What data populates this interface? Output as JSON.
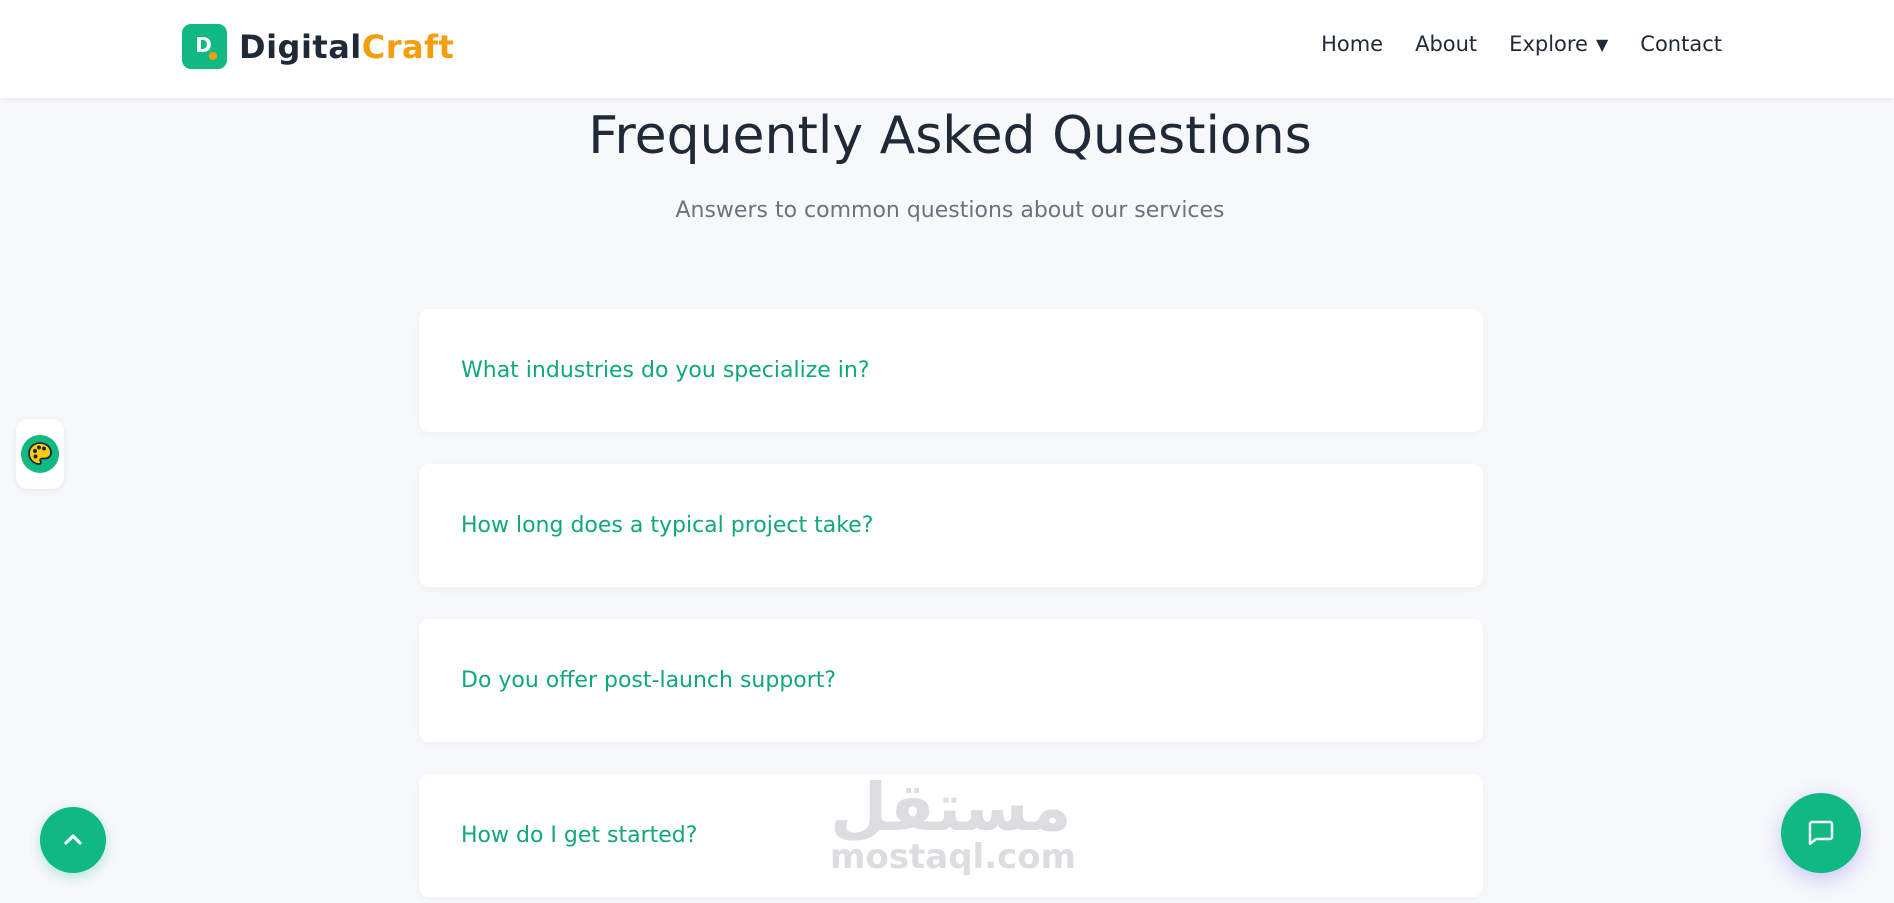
{
  "brand": {
    "mark_letter": "D",
    "name_part1": "Digital",
    "name_part2": "Craft",
    "primary_color": "#10b981",
    "accent_color": "#f59e0b"
  },
  "nav": {
    "items": [
      {
        "label": "Home"
      },
      {
        "label": "About"
      },
      {
        "label": "Explore",
        "caret": "▼"
      },
      {
        "label": "Contact"
      }
    ]
  },
  "faq": {
    "title": "Frequently Asked Questions",
    "subtitle": "Answers to common questions about our services",
    "items": [
      {
        "question": "What industries do you specialize in?"
      },
      {
        "question": "How long does a typical project take?"
      },
      {
        "question": "Do you offer post-launch support?"
      },
      {
        "question": "How do I get started?"
      }
    ]
  },
  "watermark": {
    "arabic": "مستقل",
    "latin": "mostaql.com"
  },
  "widgets": {
    "palette_icon": "palette-icon",
    "scroll_top_icon": "chevron-up-icon",
    "chat_icon": "chat-bubble-icon"
  }
}
